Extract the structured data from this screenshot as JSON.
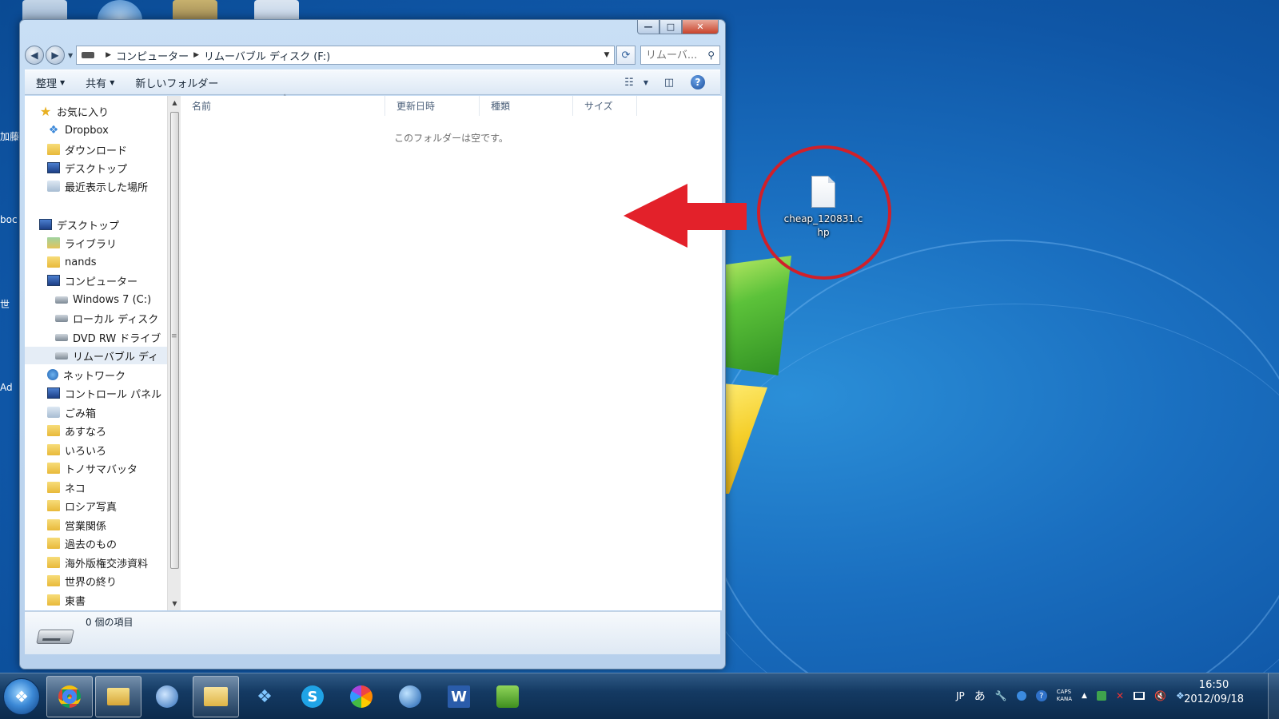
{
  "window": {
    "controls": {
      "minimize": "—",
      "maximize": "□",
      "close": "✕"
    },
    "address": {
      "crumbs": [
        "コンピューター",
        "リムーバブル ディスク (F:)"
      ]
    },
    "search": {
      "placeholder": "リムーバ..."
    },
    "toolbar": {
      "organize": "整理",
      "share": "共有",
      "new_folder": "新しいフォルダー"
    },
    "nav": {
      "favorites": [
        "お気に入り",
        "Dropbox",
        "ダウンロード",
        "デスクトップ",
        "最近表示した場所"
      ],
      "tree": [
        "デスクトップ",
        "ライブラリ",
        "nands",
        "コンピューター",
        "Windows 7 (C:)",
        "ローカル ディスク",
        "DVD RW ドライブ",
        "リムーバブル ディ",
        "ネットワーク",
        "コントロール パネル",
        "ごみ箱",
        "あすなろ",
        "いろいろ",
        "トノサマバッタ",
        "ネコ",
        "ロシア写真",
        "営業関係",
        "過去のもの",
        "海外版権交渉資料",
        "世界の終り",
        "東書"
      ]
    },
    "columns": [
      "名前",
      "更新日時",
      "種類",
      "サイズ"
    ],
    "empty_message": "このフォルダーは空です。",
    "status": "0 個の項目"
  },
  "desktop": {
    "file_name": "cheap_120831.chp",
    "edge_labels": [
      "加藤",
      "boc",
      "世",
      "Ad"
    ]
  },
  "taskbar": {
    "tray": {
      "lang": "JP",
      "ime": "あ",
      "caps": "CAPS",
      "kana": "KANA"
    },
    "clock": {
      "time": "16:50",
      "date": "2012/09/18"
    }
  },
  "colors": {
    "highlight_red": "#d0202a",
    "selected_nav": "#e5edf6"
  }
}
